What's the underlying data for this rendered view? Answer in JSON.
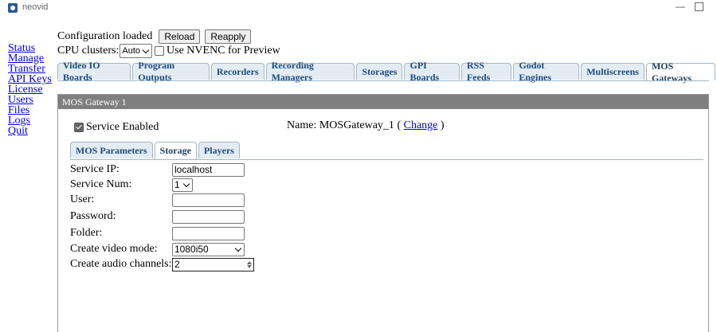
{
  "window": {
    "title": "neovid",
    "minimize": "—"
  },
  "nav": [
    "Status",
    "Manage",
    "Transfer",
    "API Keys",
    "License",
    "Users",
    "Files",
    "Logs",
    "Quit"
  ],
  "config": {
    "status": "Configuration loaded",
    "reload": "Reload",
    "reapply": "Reapply",
    "cpu_label": "CPU clusters:",
    "cpu_value": "Auto",
    "nvenc_label": "Use NVENC for Preview",
    "nvenc_checked": false
  },
  "tabs": [
    {
      "label": "Video IO Boards",
      "active": false
    },
    {
      "label": "Program Outputs",
      "active": false
    },
    {
      "label": "Recorders",
      "active": false
    },
    {
      "label": "Recording Managers",
      "active": false
    },
    {
      "label": "Storages",
      "active": false
    },
    {
      "label": "GPI Boards",
      "active": false
    },
    {
      "label": "RSS Feeds",
      "active": false
    },
    {
      "label": "Godot Engines",
      "active": false
    },
    {
      "label": "Multiscreens",
      "active": false
    },
    {
      "label": "MOS Gateways",
      "active": true
    }
  ],
  "gateway": {
    "title": "MOS Gateway 1",
    "service_enabled_label": "Service Enabled",
    "service_enabled": true,
    "name_label": "Name:",
    "name_value": "MOSGateway_1",
    "paren_open": "(",
    "paren_close": ")",
    "change_link": "Change",
    "subtabs": [
      {
        "label": "MOS Parameters",
        "active": false
      },
      {
        "label": "Storage",
        "active": true
      },
      {
        "label": "Players",
        "active": false
      }
    ],
    "fields": {
      "service_ip": {
        "label": "Service IP:",
        "value": "localhost"
      },
      "service_num": {
        "label": "Service Num:",
        "value": "1"
      },
      "user": {
        "label": "User:",
        "value": ""
      },
      "password": {
        "label": "Password:",
        "value": ""
      },
      "folder": {
        "label": "Folder:",
        "value": ""
      },
      "video_mode": {
        "label": "Create video mode:",
        "value": "1080i50"
      },
      "audio_channels": {
        "label": "Create audio channels:",
        "value": "2"
      }
    }
  }
}
